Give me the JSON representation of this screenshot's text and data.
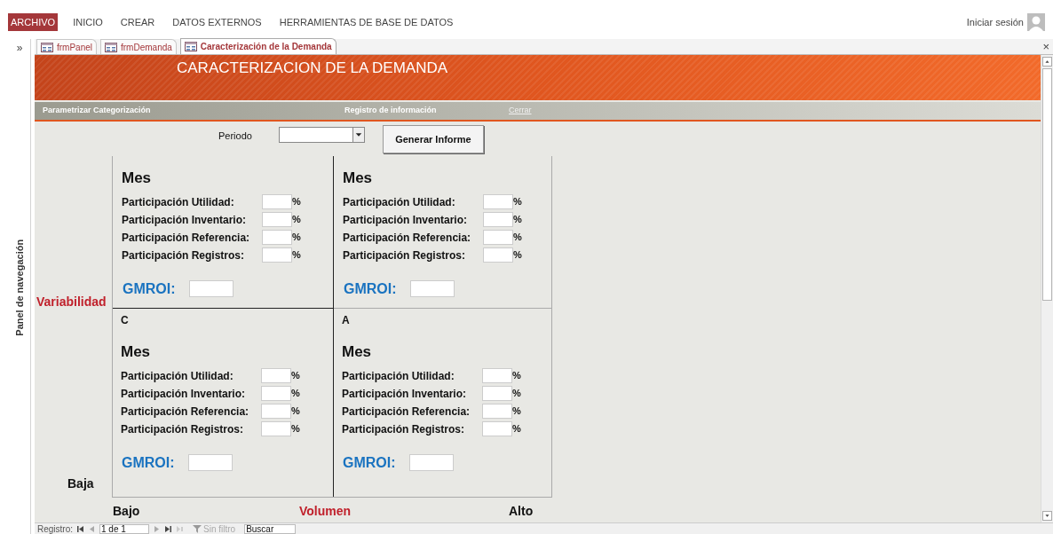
{
  "ribbon": {
    "tabs": [
      {
        "label": "ARCHIVO",
        "selected": true
      },
      {
        "label": "INICIO",
        "selected": false
      },
      {
        "label": "CREAR",
        "selected": false
      },
      {
        "label": "DATOS EXTERNOS",
        "selected": false
      },
      {
        "label": "HERRAMIENTAS DE BASE DE DATOS",
        "selected": false
      }
    ],
    "sign_in": "Iniciar sesión"
  },
  "nav_pane": {
    "toggle": "»",
    "title": "Panel de navegación"
  },
  "doc_tabs": [
    {
      "label": "frmPanel",
      "selected": false
    },
    {
      "label": "frmDemanda",
      "selected": false
    },
    {
      "label": "Caracterización de la Demanda",
      "selected": true
    }
  ],
  "close": "×",
  "form": {
    "title": "CARACTERIZACION DE LA DEMANDA",
    "menu": [
      {
        "label": "Parametrizar Categorización",
        "kind": "plain"
      },
      {
        "label": "Registro de información",
        "kind": "plain"
      },
      {
        "label": "Cerrar",
        "kind": "link"
      }
    ],
    "period_label": "Periodo",
    "generate_button": "Generar Informe",
    "y_axis": "Variabilidad",
    "y_low": "Baja",
    "x_low": "Bajo",
    "x_axis": "Volumen",
    "x_high": "Alto",
    "quadrants": [
      {
        "heading": "Mes",
        "fields": [
          {
            "label": "Participación Utilidad:",
            "unit": "%"
          },
          {
            "label": "Participación Inventario:",
            "unit": "%"
          },
          {
            "label": "Participación Referencia:",
            "unit": "%"
          },
          {
            "label": "Participación Registros:",
            "unit": "%"
          }
        ],
        "gmroi_label": "GMROI:"
      },
      {
        "heading": "Mes",
        "fields": [
          {
            "label": "Participación Utilidad:",
            "unit": "%"
          },
          {
            "label": "Participación Inventario:",
            "unit": "%"
          },
          {
            "label": "Participación Referencia:",
            "unit": "%"
          },
          {
            "label": "Participación Registros:",
            "unit": "%"
          }
        ],
        "gmroi_label": "GMROI:"
      },
      {
        "letter": "C",
        "heading": "Mes",
        "fields": [
          {
            "label": "Participación Utilidad:",
            "unit": "%"
          },
          {
            "label": "Participación Inventario:",
            "unit": "%"
          },
          {
            "label": "Participación Referencia:",
            "unit": "%"
          },
          {
            "label": "Participación Registros:",
            "unit": "%"
          }
        ],
        "gmroi_label": "GMROI:"
      },
      {
        "letter": "A",
        "heading": "Mes",
        "fields": [
          {
            "label": "Participación Utilidad:",
            "unit": "%"
          },
          {
            "label": "Participación Inventario:",
            "unit": "%"
          },
          {
            "label": "Participación Referencia:",
            "unit": "%"
          },
          {
            "label": "Participación Registros:",
            "unit": "%"
          }
        ],
        "gmroi_label": "GMROI:"
      }
    ]
  },
  "record_nav": {
    "label": "Registro:",
    "position": "1 de 1",
    "filter": "Sin filtro",
    "search_placeholder": "Buscar"
  }
}
